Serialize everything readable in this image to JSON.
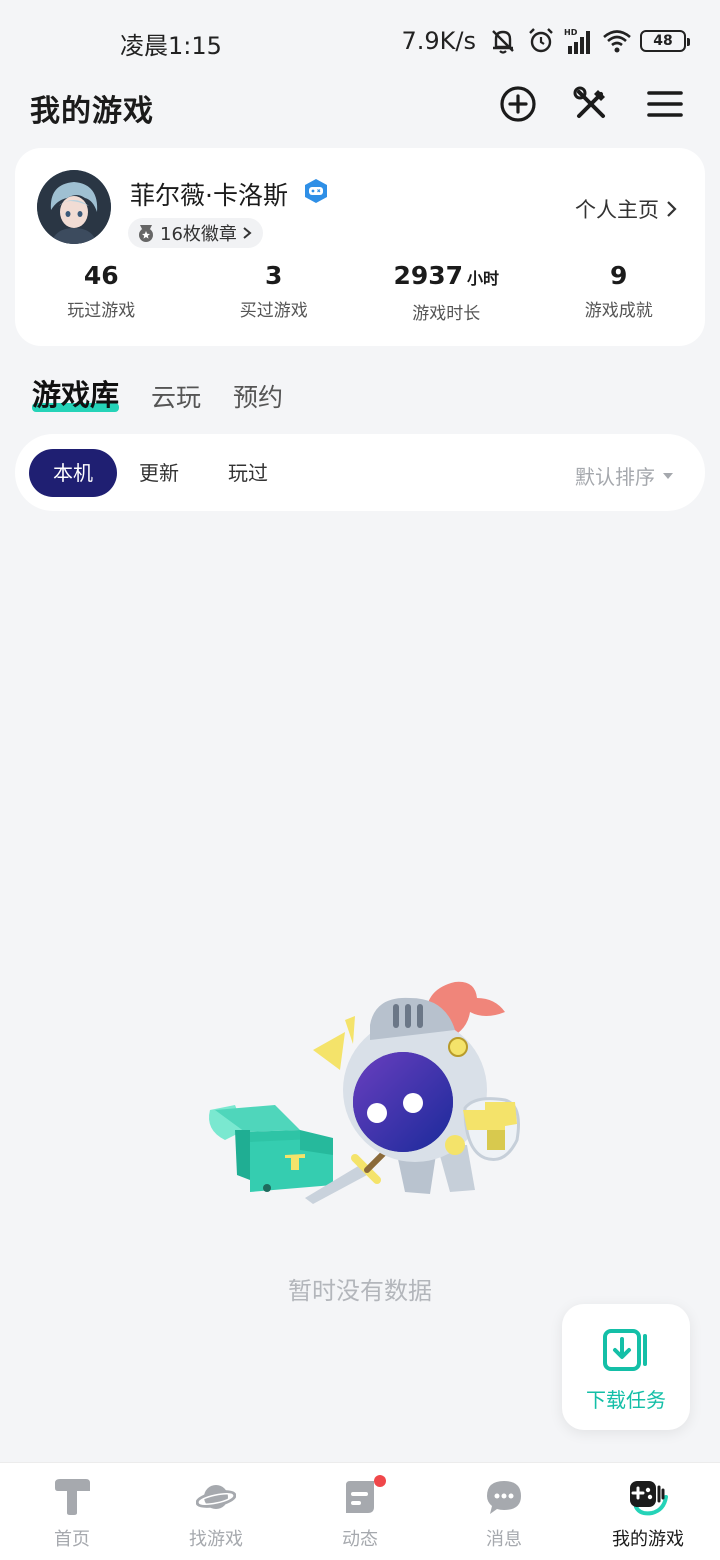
{
  "status_bar": {
    "time": "凌晨1:15",
    "network_speed": "7.9K/s",
    "battery": "48"
  },
  "header": {
    "title": "我的游戏"
  },
  "profile": {
    "username": "菲尔薇·卡洛斯",
    "medal_count": "16枚徽章",
    "homepage_label": "个人主页",
    "stats": [
      {
        "value": "46",
        "unit": "",
        "label": "玩过游戏"
      },
      {
        "value": "3",
        "unit": "",
        "label": "买过游戏"
      },
      {
        "value": "2937",
        "unit": "小时",
        "label": "游戏时长"
      },
      {
        "value": "9",
        "unit": "",
        "label": "游戏成就"
      }
    ]
  },
  "tabs": [
    {
      "label": "游戏库",
      "active": true
    },
    {
      "label": "云玩",
      "active": false
    },
    {
      "label": "预约",
      "active": false
    }
  ],
  "filters": {
    "chips": [
      {
        "label": "本机",
        "active": true
      },
      {
        "label": "更新",
        "active": false
      },
      {
        "label": "玩过",
        "active": false
      }
    ],
    "sort_label": "默认排序"
  },
  "empty_state": {
    "text": "暂时没有数据"
  },
  "download_task": {
    "label": "下载任务"
  },
  "bottom_nav": [
    {
      "label": "首页",
      "icon": "home-icon",
      "active": false
    },
    {
      "label": "找游戏",
      "icon": "planet-icon",
      "active": false
    },
    {
      "label": "动态",
      "icon": "feed-icon",
      "active": false,
      "badge": true
    },
    {
      "label": "消息",
      "icon": "chat-icon",
      "active": false
    },
    {
      "label": "我的游戏",
      "icon": "gamepad-icon",
      "active": true
    }
  ],
  "colors": {
    "accent": "#25d3b8",
    "chip_active": "#1f1f72",
    "background": "#f4f5f7",
    "badge_red": "#f0474a"
  }
}
